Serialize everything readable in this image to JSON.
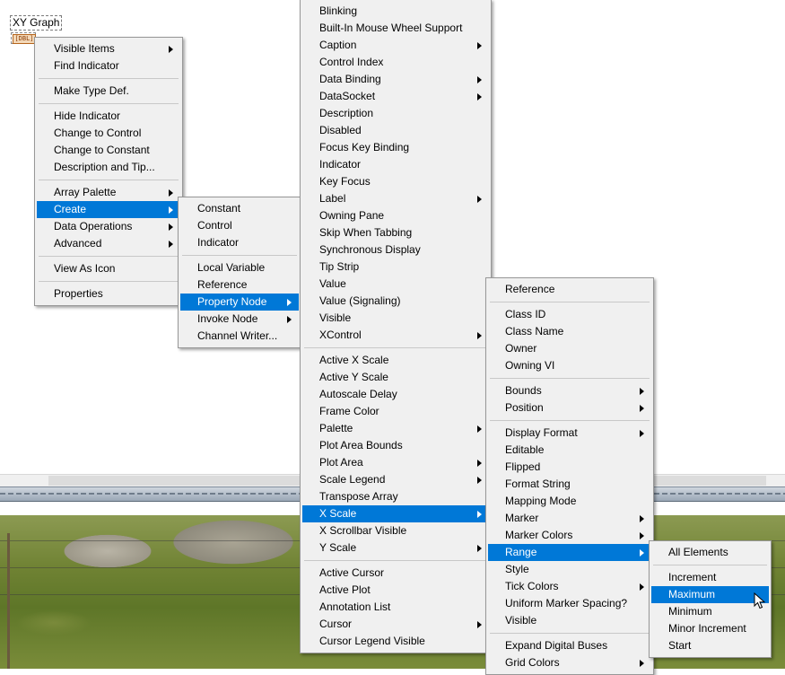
{
  "terminal": {
    "label": "XY Graph",
    "icon_text": "[DBL]"
  },
  "menu1": {
    "groups": [
      [
        {
          "label": "Visible Items",
          "sub": true
        },
        {
          "label": "Find Indicator",
          "sub": false
        }
      ],
      [
        {
          "label": "Make Type Def.",
          "sub": false
        }
      ],
      [
        {
          "label": "Hide Indicator",
          "sub": false
        },
        {
          "label": "Change to Control",
          "sub": false
        },
        {
          "label": "Change to Constant",
          "sub": false
        },
        {
          "label": "Description and Tip...",
          "sub": false
        }
      ],
      [
        {
          "label": "Array Palette",
          "sub": true
        },
        {
          "label": "Create",
          "sub": true,
          "hl": true
        },
        {
          "label": "Data Operations",
          "sub": true
        },
        {
          "label": "Advanced",
          "sub": true
        }
      ],
      [
        {
          "label": "View As Icon",
          "sub": false
        }
      ],
      [
        {
          "label": "Properties",
          "sub": false
        }
      ]
    ]
  },
  "menu2": {
    "groups": [
      [
        {
          "label": "Constant"
        },
        {
          "label": "Control"
        },
        {
          "label": "Indicator"
        }
      ],
      [
        {
          "label": "Local Variable"
        },
        {
          "label": "Reference"
        },
        {
          "label": "Property Node",
          "sub": true,
          "hl": true
        },
        {
          "label": "Invoke Node",
          "sub": true
        },
        {
          "label": "Channel Writer..."
        }
      ]
    ]
  },
  "menu3": {
    "groups": [
      [
        {
          "label": "Blinking"
        },
        {
          "label": "Built-In Mouse Wheel Support"
        },
        {
          "label": "Caption",
          "sub": true
        },
        {
          "label": "Control Index"
        },
        {
          "label": "Data Binding",
          "sub": true
        },
        {
          "label": "DataSocket",
          "sub": true
        },
        {
          "label": "Description"
        },
        {
          "label": "Disabled"
        },
        {
          "label": "Focus Key Binding"
        },
        {
          "label": "Indicator"
        },
        {
          "label": "Key Focus"
        },
        {
          "label": "Label",
          "sub": true
        },
        {
          "label": "Owning Pane"
        },
        {
          "label": "Skip When Tabbing"
        },
        {
          "label": "Synchronous Display"
        },
        {
          "label": "Tip Strip"
        },
        {
          "label": "Value"
        },
        {
          "label": "Value (Signaling)"
        },
        {
          "label": "Visible"
        },
        {
          "label": "XControl",
          "sub": true
        }
      ],
      [
        {
          "label": "Active X Scale"
        },
        {
          "label": "Active Y Scale"
        },
        {
          "label": "Autoscale Delay"
        },
        {
          "label": "Frame Color"
        },
        {
          "label": "Palette",
          "sub": true
        },
        {
          "label": "Plot Area Bounds"
        },
        {
          "label": "Plot Area",
          "sub": true
        },
        {
          "label": "Scale Legend",
          "sub": true
        },
        {
          "label": "Transpose Array"
        },
        {
          "label": "X Scale",
          "sub": true,
          "hl": true
        },
        {
          "label": "X Scrollbar Visible"
        },
        {
          "label": "Y Scale",
          "sub": true
        }
      ],
      [
        {
          "label": "Active Cursor"
        },
        {
          "label": "Active Plot"
        },
        {
          "label": "Annotation List"
        },
        {
          "label": "Cursor",
          "sub": true
        },
        {
          "label": "Cursor Legend Visible"
        }
      ]
    ]
  },
  "menu4": {
    "groups": [
      [
        {
          "label": "Reference"
        }
      ],
      [
        {
          "label": "Class ID"
        },
        {
          "label": "Class Name"
        },
        {
          "label": "Owner"
        },
        {
          "label": "Owning VI"
        }
      ],
      [
        {
          "label": "Bounds",
          "sub": true
        },
        {
          "label": "Position",
          "sub": true
        }
      ],
      [
        {
          "label": "Display Format",
          "sub": true
        },
        {
          "label": "Editable"
        },
        {
          "label": "Flipped"
        },
        {
          "label": "Format String"
        },
        {
          "label": "Mapping Mode"
        },
        {
          "label": "Marker",
          "sub": true
        },
        {
          "label": "Marker Colors",
          "sub": true
        },
        {
          "label": "Range",
          "sub": true,
          "hl": true
        },
        {
          "label": "Style"
        },
        {
          "label": "Tick Colors",
          "sub": true
        },
        {
          "label": "Uniform Marker Spacing?"
        },
        {
          "label": "Visible"
        }
      ],
      [
        {
          "label": "Expand Digital Buses"
        },
        {
          "label": "Grid Colors",
          "sub": true
        }
      ]
    ]
  },
  "menu5": {
    "groups": [
      [
        {
          "label": "All Elements"
        }
      ],
      [
        {
          "label": "Increment"
        },
        {
          "label": "Maximum",
          "hl": true
        },
        {
          "label": "Minimum"
        },
        {
          "label": "Minor Increment"
        },
        {
          "label": "Start"
        }
      ]
    ]
  },
  "colors": {
    "highlight": "#0078d7",
    "menu_bg": "#f0f0f0"
  }
}
